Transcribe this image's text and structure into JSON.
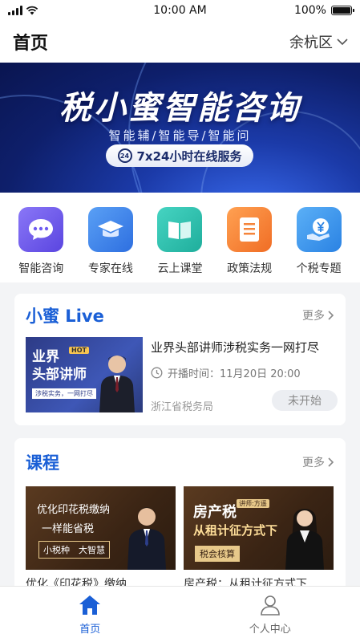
{
  "status_bar": {
    "time": "10:00 AM",
    "battery": "100%",
    "battery_level": 1.0
  },
  "header": {
    "title": "首页",
    "region": "余杭区"
  },
  "banner": {
    "title": "税小蜜智能咨询",
    "subtitle": "智能辅/智能导/智能问",
    "pill_icon_text": "24",
    "pill_text": "7x24小时在线服务"
  },
  "grid": [
    {
      "label": "智能咨询",
      "icon": "chat-bubble-icon",
      "color": "#6e5cf0"
    },
    {
      "label": "专家在线",
      "icon": "graduation-cap-icon",
      "color": "#3f86ee"
    },
    {
      "label": "云上课堂",
      "icon": "open-book-icon",
      "color": "#2fc1b0"
    },
    {
      "label": "政策法规",
      "icon": "document-list-icon",
      "color": "#f5853b"
    },
    {
      "label": "个税专题",
      "icon": "yen-hand-icon",
      "color": "#3994ee"
    }
  ],
  "live": {
    "title": "小蜜 Live",
    "more": "更多",
    "thumb_line1": "业界",
    "thumb_line2": "头部讲师",
    "thumb_hot": "HOT",
    "thumb_tag": "涉税实务，一网打尽",
    "item_title": "业界头部讲师涉税实务一网打尽",
    "item_time": "开播时间：11月20日 20:00",
    "item_org": "浙江省税务局",
    "item_status": "未开始"
  },
  "courses": {
    "title": "课程",
    "more": "更多",
    "items": [
      {
        "line1": "优化印花税缴纳",
        "line2": "一样能省税",
        "tag": "小税种　大智慧",
        "name": "优化《印花税》缴纳"
      },
      {
        "big": "房产税",
        "badge": "讲师:方遥",
        "big2": "从租计征方式下",
        "tag": "税会核算",
        "name": "房产税：从租计征方式下"
      }
    ]
  },
  "tabbar": [
    {
      "label": "首页",
      "icon": "home-icon",
      "active": true
    },
    {
      "label": "个人中心",
      "icon": "user-icon",
      "active": false
    }
  ],
  "colors": {
    "accent": "#1a5fd6",
    "tab_inactive": "#666666"
  }
}
